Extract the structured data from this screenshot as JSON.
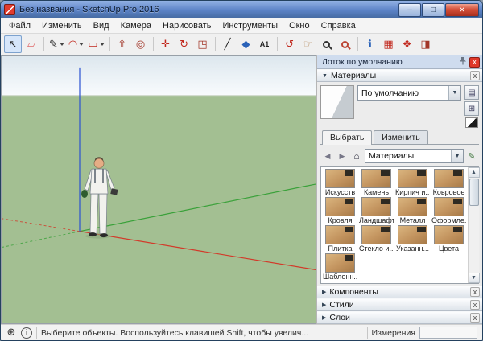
{
  "window": {
    "title": "Без названия - SketchUp Pro 2016",
    "minimize_glyph": "–",
    "maximize_glyph": "□",
    "close_glyph": "×"
  },
  "menu": {
    "items": [
      "Файл",
      "Изменить",
      "Вид",
      "Камера",
      "Нарисовать",
      "Инструменты",
      "Окно",
      "Справка"
    ]
  },
  "toolbar": {
    "buttons": [
      {
        "name": "select",
        "glyph": "↖"
      },
      {
        "name": "eraser",
        "glyph": "▱"
      },
      {
        "name": "line",
        "glyph": "✎"
      },
      {
        "name": "arc",
        "glyph": "◠"
      },
      {
        "name": "shapes",
        "glyph": "▭"
      },
      {
        "name": "push-pull",
        "glyph": "⇧"
      },
      {
        "name": "offset",
        "glyph": "◎"
      },
      {
        "name": "move",
        "glyph": "✛"
      },
      {
        "name": "rotate",
        "glyph": "↻"
      },
      {
        "name": "scale",
        "glyph": "◳"
      },
      {
        "name": "tape-measure",
        "glyph": "╱"
      },
      {
        "name": "paint-bucket",
        "glyph": "◆"
      },
      {
        "name": "text",
        "glyph": "A1"
      },
      {
        "name": "orbit",
        "glyph": "↺"
      },
      {
        "name": "pan",
        "glyph": "☞"
      },
      {
        "name": "zoom",
        "glyph": ""
      },
      {
        "name": "zoom-extents",
        "glyph": ""
      },
      {
        "name": "model-info",
        "glyph": "ℹ"
      },
      {
        "name": "warehouse-3d",
        "glyph": "▦"
      },
      {
        "name": "extension-warehouse",
        "glyph": "❖"
      },
      {
        "name": "send-to-layout",
        "glyph": "◨"
      }
    ]
  },
  "tray": {
    "title": "Лоток по умолчанию",
    "materials": {
      "title": "Материалы",
      "current_material": "По умолчанию",
      "tabs": {
        "select": "Выбрать",
        "edit": "Изменить"
      },
      "collection": "Материалы",
      "categories": [
        "Искусств",
        "Камень",
        "Кирпич и...",
        "Ковровое",
        "Кровля",
        "Ландшафт",
        "Металл",
        "Оформле...",
        "Плитка",
        "Стекло и...",
        "Указанн...",
        "Цвета",
        "Шаблонн..."
      ]
    },
    "sections": [
      {
        "title": "Компоненты"
      },
      {
        "title": "Стили"
      },
      {
        "title": "Слои"
      }
    ]
  },
  "statusbar": {
    "message": "Выберите объекты. Воспользуйтесь клавишей Shift, чтобы увелич...",
    "measurements_label": "Измерения",
    "measurements_value": ""
  },
  "icons": {
    "dropdown_arrow": "▼",
    "combo_arrow": "▼",
    "section_collapsed": "▶",
    "section_expanded": "▼",
    "close": "x",
    "back": "◀",
    "forward": "▶",
    "home": "⌂",
    "scroll_up": "▲",
    "scroll_down": "▼",
    "geolocation": "⊕",
    "info": "i",
    "sample_paint": "✎",
    "pane": "▤",
    "create_material": "⊞"
  },
  "colors": {
    "titlebar_blue": "#5b82c6",
    "close_red": "#d4503a",
    "tray_close_red": "#e0382a",
    "ground_green": "#a3bf92",
    "sky": "#e3ebf1",
    "axis_red": "#d23a2a",
    "axis_green": "#3aa13a",
    "axis_blue": "#2a52d2"
  }
}
